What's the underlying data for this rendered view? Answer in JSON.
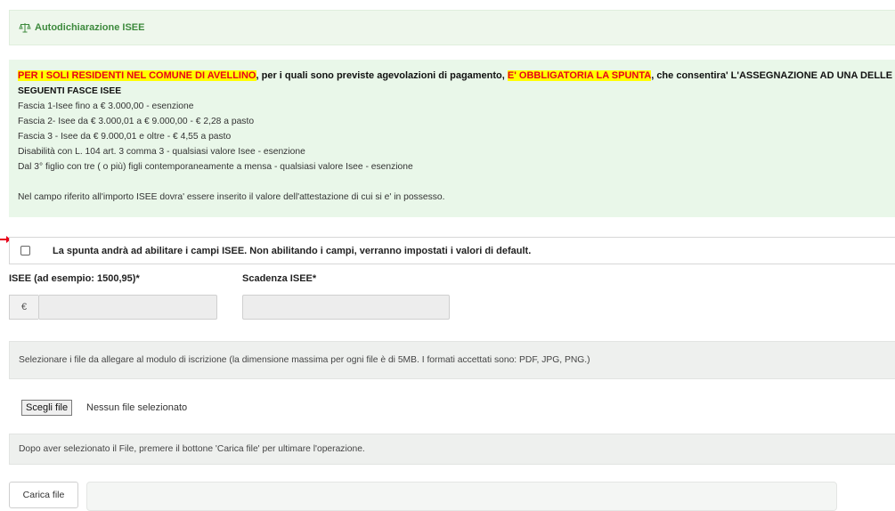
{
  "header": {
    "title": "Autodichiarazione ISEE",
    "icon": "scale-icon",
    "accent": "#3d8a3d"
  },
  "notice": {
    "hl_residents": "PER I SOLI RESIDENTI NEL COMUNE DI AVELLINO",
    "text_1": ", per i quali sono previste agevolazioni di pagamento, ",
    "hl_mandatory": "E' OBBLIGATORIA LA SPUNTA",
    "text_2": ", che consentira' L'ASSEGNAZIONE AD UNA DELLE",
    "bands_title": "SEGUENTI FASCE ISEE",
    "lines": [
      "Fascia 1-Isee fino a € 3.000,00 - esenzione",
      "Fascia 2- Isee da € 3.000,01 a € 9.000,00 - € 2,28 a pasto",
      "Fascia 3 - Isee da € 9.000,01 e oltre - € 4,55 a pasto",
      "Disabilità con L. 104 art. 3 comma 3 - qualsiasi valore Isee - esenzione",
      "Dal 3° figlio con tre ( o più) figli contemporaneamente a mensa  - qualsiasi valore Isee - esenzione"
    ],
    "footer": "Nel campo riferito all'importo ISEE dovra' essere inserito il valore dell'attestazione di cui si e' in possesso.",
    "highlight_bg": "#ffff00",
    "highlight_fg": "#e8001a"
  },
  "enable_checkbox": {
    "label": "La spunta andrà ad abilitare i campi ISEE. Non abilitando i campi, verranno impostati i valori di default.",
    "checked": false
  },
  "isee_field": {
    "label": "ISEE (ad esempio: 1500,95)*",
    "prefix": "€",
    "value": ""
  },
  "expiry_field": {
    "label": "Scadenza ISEE*",
    "value": ""
  },
  "attachments": {
    "instructions": "Selezionare i file da allegare al modulo di iscrizione (la dimensione massima per ogni file è di 5MB. I formati accettati sono: PDF, JPG, PNG.)",
    "choose_button": "Scegli file",
    "status": "Nessun file selezionato",
    "upload_hint": "Dopo aver selezionato il File, premere il bottone 'Carica file' per ultimare l'operazione.",
    "upload_button": "Carica file"
  }
}
